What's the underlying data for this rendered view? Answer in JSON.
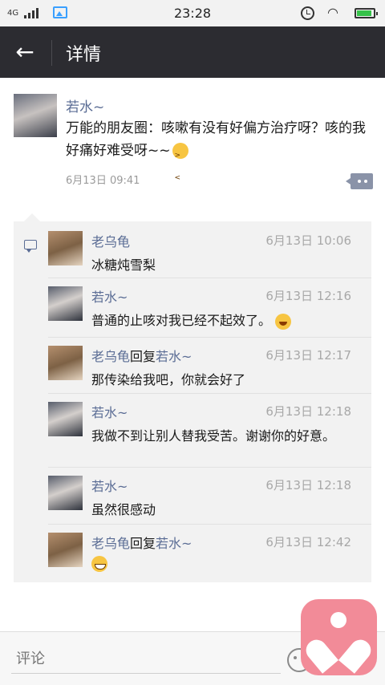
{
  "status_bar": {
    "network": "4G",
    "time": "23:28"
  },
  "header": {
    "title": "详情",
    "back_icon": "back-arrow-icon"
  },
  "post": {
    "author": "若水~",
    "text": "万能的朋友圈：咳嗽有没有好偏方治疗呀？咳的我好痛好难受呀~~",
    "time": "6月13日 09:41"
  },
  "comments": [
    {
      "author": "老乌龟",
      "reply_word": "",
      "reply_to": "",
      "time": "6月13日 10:06",
      "text": "冰糖炖雪梨"
    },
    {
      "author": "若水~",
      "reply_word": "",
      "reply_to": "",
      "time": "6月13日 12:16",
      "text": "普通的止咳对我已经不起效了。"
    },
    {
      "author": "老乌龟",
      "reply_word": "回复",
      "reply_to": "若水~",
      "time": "6月13日 12:17",
      "text": "那传染给我吧，你就会好了"
    },
    {
      "author": "若水~",
      "reply_word": "",
      "reply_to": "",
      "time": "6月13日 12:18",
      "text": "我做不到让别人替我受苦。谢谢你的好意。"
    },
    {
      "author": "若水~",
      "reply_word": "",
      "reply_to": "",
      "time": "6月13日 12:18",
      "text": "虽然很感动"
    },
    {
      "author": "老乌龟",
      "reply_word": "回复",
      "reply_to": "若水~",
      "time": "6月13日 12:42",
      "text": ""
    }
  ],
  "input": {
    "placeholder": "评论"
  },
  "colors": {
    "header_bg": "#2c2c31",
    "name_blue": "#5b6d95",
    "floating_pink": "#f28b98"
  }
}
